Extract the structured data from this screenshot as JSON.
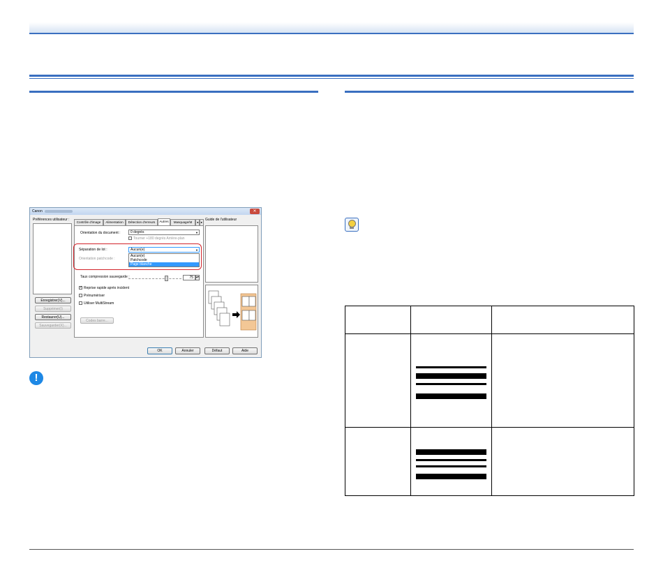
{
  "dialog": {
    "title": "Canon",
    "close_glyph": "✕",
    "user_prefs_label": "Préférences utilisateur :",
    "user_guide_label": "Guide de l'utilisateur",
    "left_buttons": {
      "save": "Enregistrer(V)...",
      "delete": "Supprimer(I)",
      "restore": "Restaurer(U)...",
      "backup": "Sauvegarder(X)..."
    },
    "tabs": [
      "Contrôle d'image",
      "Alimentation",
      "Détection d'erreurs",
      "Autres",
      "Masquage/M",
      "◂",
      "▸"
    ],
    "doc_orientation_label": "Orientation du document :",
    "doc_orientation_value": "0 degrés",
    "rotate_checkbox_label": "Tourner +180 degrés Arrière-plan",
    "batch_separation_label": "Séparation de lot :",
    "batch_separation_value": "Aucun(e)",
    "patchcode_orientation_label": "Orientation patchcode :",
    "batch_options": [
      "Aucun(e)",
      "Patchcode",
      "Page blanche"
    ],
    "compression_label": "Taux compression sauvegarde :",
    "compression_value": "75",
    "rapid_recovery_label": "Reprise rapide après incident",
    "prescan_label": "Prénumériser",
    "multistream_label": "Utiliser MultiStream",
    "barcode_button": "Codes barre...",
    "bottom_buttons": {
      "ok": "OK",
      "cancel": "Annuler",
      "default": "Défaut",
      "help": "Aide"
    }
  },
  "icons": {
    "info": "!",
    "tip": "lightbulb"
  },
  "colors": {
    "accent_blue": "#3a6fc0",
    "highlight_red": "#d2232a",
    "info_blue": "#1e88e5"
  }
}
